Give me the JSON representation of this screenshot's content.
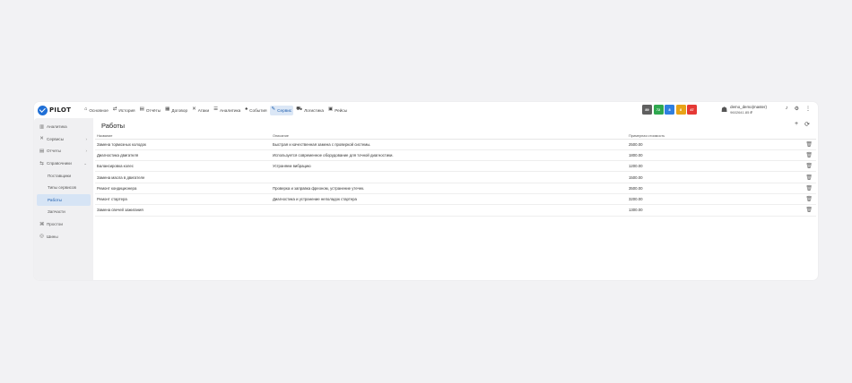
{
  "brand": {
    "name": "PILOT"
  },
  "nav": [
    {
      "icon": "⌂",
      "icon_name": "home-icon",
      "label": "Основное"
    },
    {
      "icon": "⇄",
      "icon_name": "history-icon",
      "label": "История"
    },
    {
      "icon": "▤",
      "icon_name": "report-icon",
      "label": "Отчёты"
    },
    {
      "icon": "▦",
      "icon_name": "contract-icon",
      "label": "Договор"
    },
    {
      "icon": "✕",
      "icon_name": "tools-icon",
      "label": "Атаки"
    },
    {
      "icon": "☰",
      "icon_name": "analytics-icon",
      "label": "Аналитика"
    },
    {
      "icon": "♠",
      "icon_name": "bell-icon",
      "label": "События"
    },
    {
      "icon": "✎",
      "icon_name": "wrench-icon",
      "label": "Сервис"
    },
    {
      "icon": "⛟",
      "icon_name": "truck-icon",
      "label": "Логистика"
    },
    {
      "icon": "▣",
      "icon_name": "bus-icon",
      "label": "Рейсы"
    }
  ],
  "status_badges": [
    {
      "value": "89",
      "color": "#5f5f5f"
    },
    {
      "value": "72",
      "color": "#2fa84f"
    },
    {
      "value": "8",
      "color": "#2f7fe0"
    },
    {
      "value": "8",
      "color": "#e8a317"
    },
    {
      "value": "47",
      "color": "#e53935"
    }
  ],
  "user": {
    "name": "demo_demo(master)",
    "balance": "9602641.85 ₽"
  },
  "sidebar": [
    {
      "icon": "▥",
      "icon_name": "chart-icon",
      "label": "Аналитика",
      "chevron": ""
    },
    {
      "icon": "✕",
      "icon_name": "tools-icon",
      "label": "Сервисы",
      "chevron": "›"
    },
    {
      "icon": "▤",
      "icon_name": "report-icon",
      "label": "Отчеты",
      "chevron": "›"
    },
    {
      "icon": "⇆",
      "icon_name": "directory-icon",
      "label": "Справочники",
      "chevron": "⌄"
    },
    {
      "label": "Поставщики",
      "sub": true
    },
    {
      "label": "Типы сервисов",
      "sub": true
    },
    {
      "label": "Работы",
      "sub": true,
      "active": true
    },
    {
      "label": "Запчасти",
      "sub": true
    },
    {
      "icon": "⌘",
      "icon_name": "downtime-icon",
      "label": "Простои",
      "chevron": ""
    },
    {
      "icon": "◎",
      "icon_name": "tire-icon",
      "label": "Шины",
      "chevron": ""
    }
  ],
  "page": {
    "title": "Работы"
  },
  "table": {
    "headers": [
      "Название",
      "Описание",
      "Примерная стоимость"
    ],
    "rows": [
      [
        "Замена тормозных колодок",
        "Быстрая и качественная замена с проверкой системы.",
        "2500.00"
      ],
      [
        "Диагностика двигателя",
        "Используется современное оборудование для точной диагностики.",
        "1800.00"
      ],
      [
        "Балансировка колес",
        "Устраняем вибрацию",
        "1200.00"
      ],
      [
        "Замена масла в двигателе",
        "",
        "1500.00"
      ],
      [
        "Ремонт кондиционера",
        "Проверка и заправка фреоном, устранение утечек.",
        "3500.00"
      ],
      [
        "Ремонт стартера",
        "Диагностика и устранение неполадок стартера",
        "3200.00"
      ],
      [
        "Замена свечей зажигания",
        "",
        "1300.00"
      ]
    ]
  }
}
